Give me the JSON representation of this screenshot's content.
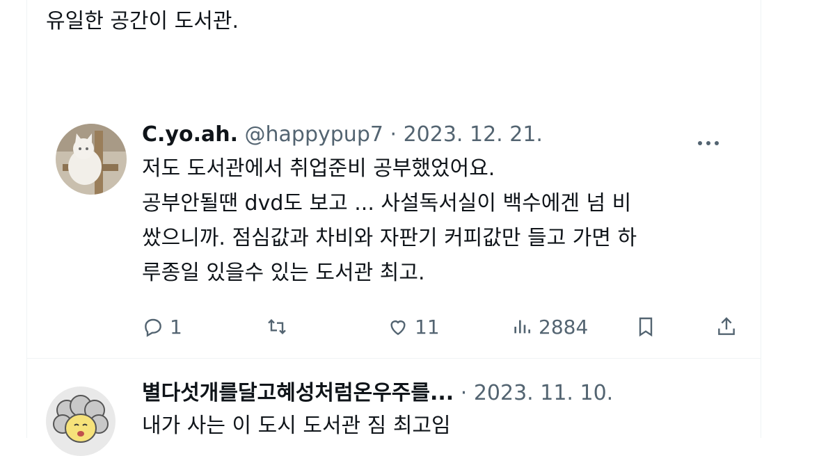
{
  "previous_tweet": {
    "text_line2": "유일한 공간이 도서관."
  },
  "reply1": {
    "display_name": "C.yo.ah.",
    "handle": "@happypup7",
    "separator": " · ",
    "date": "2023. 12. 21.",
    "more_icon": "more-horizontal-icon",
    "lines": [
      "저도 도서관에서 취업준비 공부했었어요.",
      "공부안될땐 dvd도 보고 ... 사설독서실이 백수에겐 넘 비",
      "쌌으니까. 점심값과 차비와 자판기 커피값만 들고 가면 하",
      "루종일 있을수 있는 도서관 최고."
    ],
    "actions": {
      "reply_count": "1",
      "retweet_count": "",
      "like_count": "11",
      "view_count": "2884"
    }
  },
  "reply2": {
    "display_name": "별다섯개를달고혜성처럼온우주를...",
    "separator": " · ",
    "date": "2023. 11. 10.",
    "lines": [
      "내가 사는 이 도시 도서관 짐 최고임"
    ]
  },
  "colors": {
    "text": "#0f1419",
    "secondary": "#536471",
    "divider": "#eff3f4"
  }
}
